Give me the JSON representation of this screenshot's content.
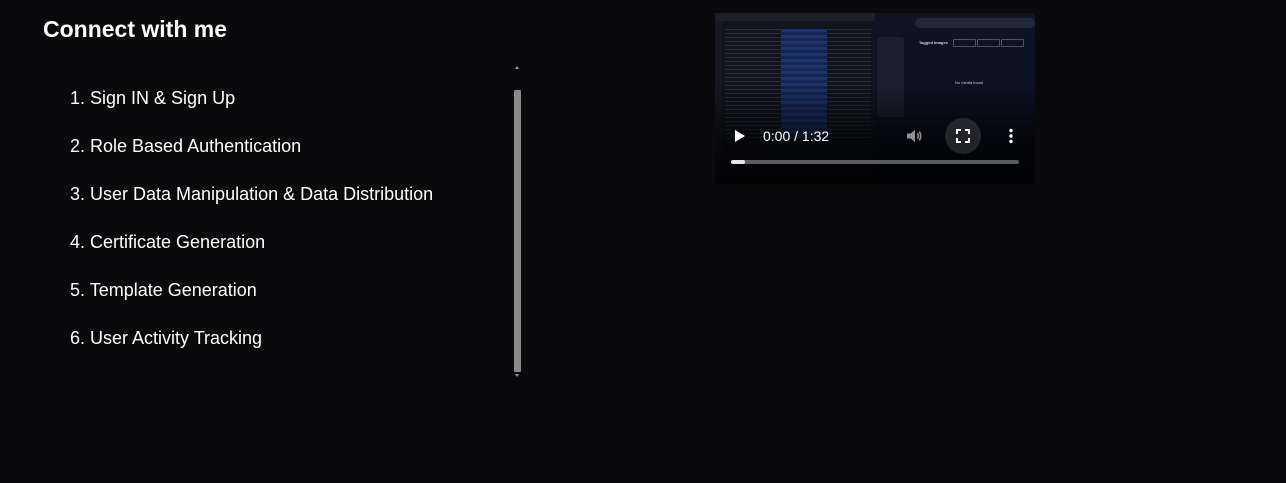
{
  "section": {
    "title": "Connect with me"
  },
  "features": [
    {
      "label": "1. Sign IN & Sign Up"
    },
    {
      "label": "2. Role Based Authentication"
    },
    {
      "label": "3. User Data Manipulation & Data Distribution"
    },
    {
      "label": "4. Certificate Generation"
    },
    {
      "label": "5. Template Generation"
    },
    {
      "label": "6. User Activity Tracking"
    }
  ],
  "video": {
    "time_display": "0:00 / 1:32",
    "buffered_fraction": 0.05,
    "thumbnail": {
      "panel_title": "Tagged Images",
      "empty_message": "No media found"
    },
    "controls": {
      "play_icon": "play-icon",
      "volume_icon": "volume-icon",
      "fullscreen_icon": "fullscreen-icon",
      "more_icon": "more-vertical-icon"
    }
  },
  "colors": {
    "background": "#0a0a0c",
    "text": "#ffffff",
    "scrollbar_thumb": "#8a8a8a"
  }
}
